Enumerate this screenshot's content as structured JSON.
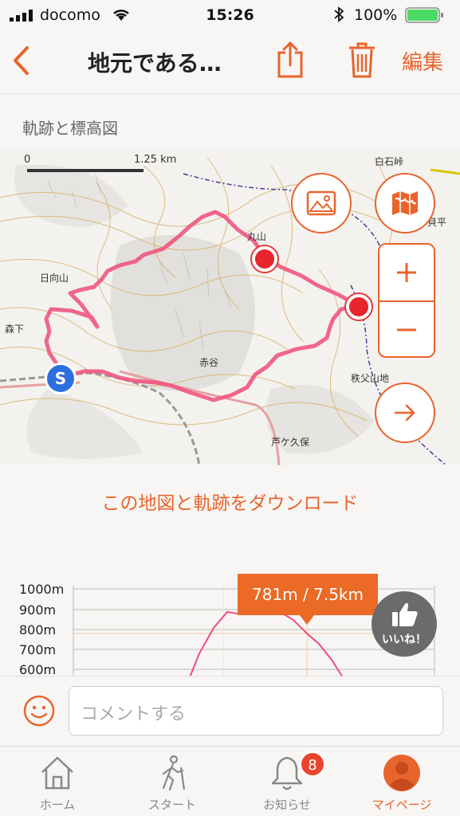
{
  "status_bar": {
    "carrier": "docomo",
    "time": "15:26",
    "battery_pct": "100%"
  },
  "nav": {
    "title": "地元である…",
    "edit_label": "編集"
  },
  "section": {
    "track_label": "軌跡と標高図"
  },
  "map": {
    "scale_zero": "0",
    "scale_dist": "1.25 km",
    "place_names": {
      "shiraishi": "白石峠",
      "maruyama": "丸山",
      "hinatayama": "日向山",
      "morishita": "森下",
      "akaya": "赤谷",
      "chichibu": "秩父山地",
      "ashigakubo": "芦ケ久保",
      "kaihira": "貝平"
    },
    "start_marker": "S",
    "route_color": "#f0567f",
    "accent_color": "#e8642c"
  },
  "download_link": "この地図と軌跡をダウンロード",
  "elevation": {
    "y_labels": [
      "1000m",
      "900m",
      "800m",
      "700m",
      "600m"
    ],
    "tooltip": "781m / 7.5km"
  },
  "like": {
    "label": "いいね！"
  },
  "comment": {
    "placeholder": "コメントする"
  },
  "tabs": [
    {
      "label": "ホーム",
      "icon": "home-icon"
    },
    {
      "label": "スタート",
      "icon": "walker-icon"
    },
    {
      "label": "お知らせ",
      "icon": "bell-icon",
      "badge": "8"
    },
    {
      "label": "マイページ",
      "icon": "user-icon",
      "active": true
    }
  ]
}
